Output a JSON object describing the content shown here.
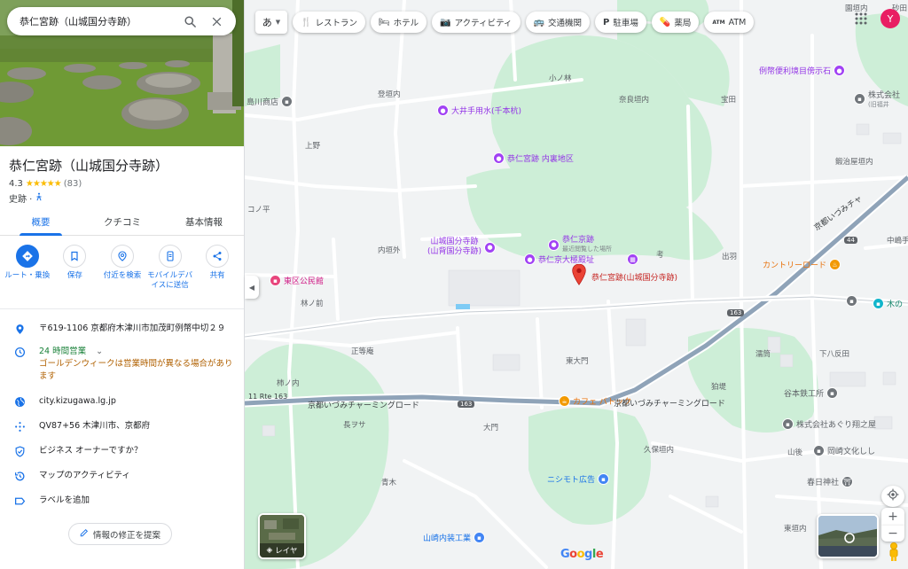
{
  "search": {
    "query": "恭仁宮跡（山城国分寺跡）"
  },
  "place": {
    "title": "恭仁宮跡（山城国分寺跡）",
    "rating": "4.3",
    "stars": "★★★★★",
    "review_count": "(83)",
    "category": "史跡 ·"
  },
  "tabs": [
    {
      "label": "概要"
    },
    {
      "label": "クチコミ"
    },
    {
      "label": "基本情報"
    }
  ],
  "actions": [
    {
      "label": "ルート・乗換"
    },
    {
      "label": "保存"
    },
    {
      "label": "付近を検索"
    },
    {
      "label": "モバイルデバイスに送信"
    },
    {
      "label": "共有"
    }
  ],
  "info": {
    "address": "〒619-1106 京都府木津川市加茂町例幣中切２９",
    "hours": "24 時間営業",
    "hours_note": "ゴールデンウィークは営業時間が異なる場合があります",
    "website": "city.kizugawa.lg.jp",
    "plus_code": "QV87+56 木津川市、京都府",
    "owner": "ビジネス オーナーですか？",
    "activity": "マップのアクティビティ",
    "label": "ラベルを追加"
  },
  "suggest_edit": "情報の修正を提案",
  "chips": {
    "ime": "あ",
    "items": [
      {
        "icon": "🍴",
        "label": "レストラン"
      },
      {
        "icon": "🛏",
        "label": "ホテル"
      },
      {
        "icon": "📷",
        "label": "アクティビティ"
      },
      {
        "icon": "🚌",
        "label": "交通機関"
      },
      {
        "icon": "P",
        "label": "駐車場"
      },
      {
        "icon": "💊",
        "label": "薬局"
      },
      {
        "icon": "ATM",
        "label": "ATM"
      }
    ]
  },
  "user_initial": "Y",
  "map": {
    "pin_label": "恭仁宮跡(山城国分寺跡)",
    "labels": {
      "l1": "園垣内",
      "l2": "砂田",
      "l3": "登垣内",
      "l4": "小ノ林",
      "l5": "奈良垣内",
      "l6": "宝田",
      "l7": "上野",
      "l8": "鍛治屋垣内",
      "l9": "コノ平",
      "l10": "内垣外",
      "l11": "考",
      "l12": "出羽",
      "l13": "中嶋手",
      "l14": "林ノ前",
      "l15": "正等庵",
      "l16": "東大門",
      "l17": "濡筒",
      "l18": "下八反田",
      "l19": "柿ノ内",
      "l20": "狛堤",
      "l21": "長ヲサ",
      "l22": "大門",
      "l23": "久保垣内",
      "l24": "山後",
      "l25": "青木",
      "l26": "東垣内"
    },
    "pois": {
      "p1": "例幣便利境目傍示石",
      "p2": "株式会社",
      "p2b": "(旧福井",
      "p3": "島川商店",
      "p4": "大井手用水(千本杭)",
      "p5": "恭仁宮跡 内裏地区",
      "p6": "山城国分寺跡",
      "p6b": "(山背国分寺跡)",
      "p7": "恭仁京跡",
      "p7b": "最近閲覧した場所",
      "p8": "恭仁京大極殿址",
      "p9": "東区公民館",
      "p10": "カントリーロード",
      "p11": "木の",
      "p12": "カフェ バトック",
      "p13": "谷本鉄工所",
      "p14": "株式会社あぐり翔之屋",
      "p15": "岡崎文化しし",
      "p16": "ニシモト広告",
      "p17": "春日神社",
      "p18": "山崎内装工業"
    },
    "roads": {
      "r1": "京都いづみチャーミングロード",
      "r2": "京都いづみチャーミングロード",
      "r3": "京都いづみチャ",
      "r4": "11 Rte 163"
    },
    "shields": {
      "s1": "163",
      "s2": "163",
      "s3": "44"
    },
    "layers_label": "レイヤ"
  },
  "colors": {
    "accent": "#1a73e8",
    "pin": "#ea4335",
    "poi": "#a142f4",
    "avatar": "#e91e63"
  }
}
